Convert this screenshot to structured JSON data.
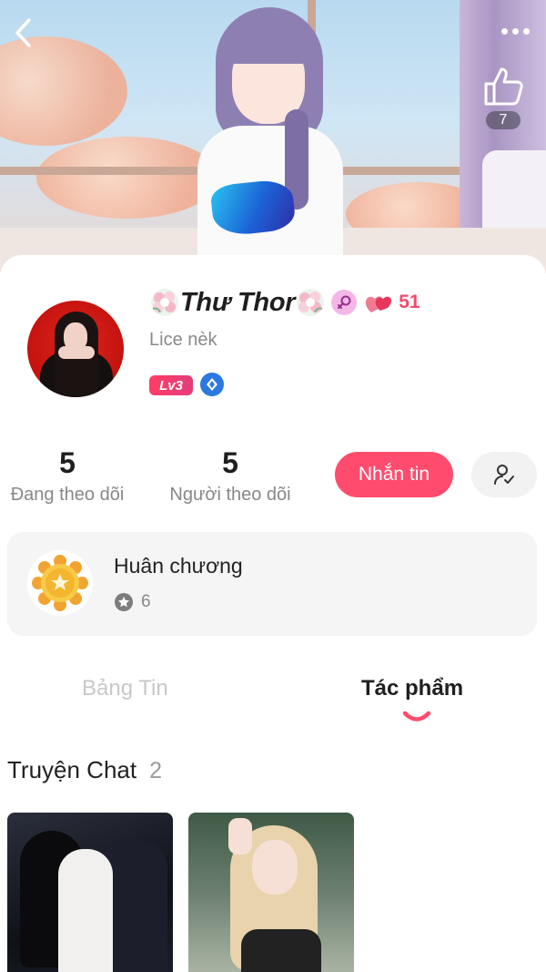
{
  "header": {
    "like_count": "7"
  },
  "profile": {
    "name": "Thư Thor",
    "bio": "Lice nèk",
    "heart_count": "51",
    "level_badge": "Lv3"
  },
  "stats": {
    "following_count": "5",
    "following_label": "Đang theo dõi",
    "followers_count": "5",
    "followers_label": "Người theo dõi"
  },
  "actions": {
    "message_label": "Nhắn tin"
  },
  "medals": {
    "title": "Huân chương",
    "count": "6"
  },
  "tabs": [
    {
      "label": "Bảng Tin",
      "active": false
    },
    {
      "label": "Tác phẩm",
      "active": true
    }
  ],
  "section": {
    "title": "Truyện Chat",
    "count": "2"
  },
  "colors": {
    "accent": "#ff4c6e",
    "heart": "#f04a6c",
    "level_badge": "#ff3d66",
    "diamond_badge": "#2b79e0"
  }
}
